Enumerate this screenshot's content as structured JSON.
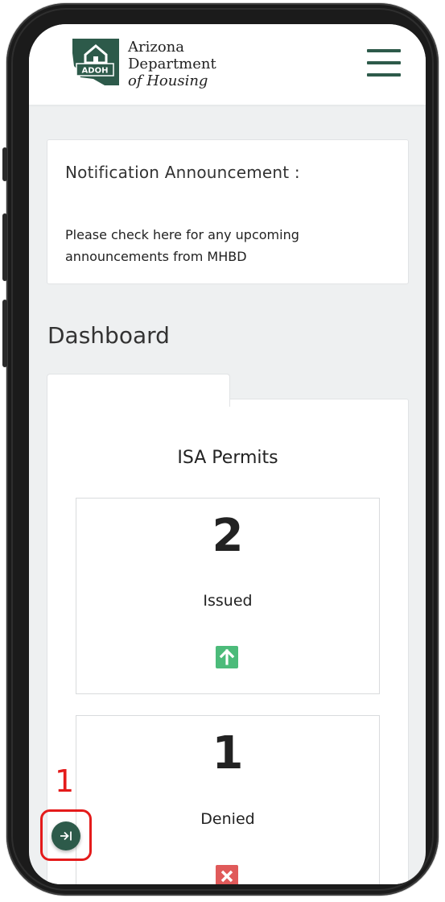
{
  "header": {
    "org_line1": "Arizona",
    "org_line2": "Department",
    "org_line3": "of Housing",
    "logo_badge": "ADOH",
    "menu_icon": "hamburger-menu-icon"
  },
  "notification": {
    "title": "Notification Announcement :",
    "text": "Please check here for any upcoming announcements from MHBD"
  },
  "dashboard": {
    "title": "Dashboard",
    "panel_title": "ISA Permits",
    "cards": [
      {
        "value": "2",
        "label": "Issued",
        "icon": "arrow-up-icon",
        "color": "#4cbb7a"
      },
      {
        "value": "1",
        "label": "Denied",
        "icon": "close-x-icon",
        "color": "#e05a5a"
      }
    ]
  },
  "annotation": {
    "marker": "1",
    "color": "#e41b1b"
  },
  "colors": {
    "brand": "#2d5a4a",
    "background": "#eef0f1"
  }
}
